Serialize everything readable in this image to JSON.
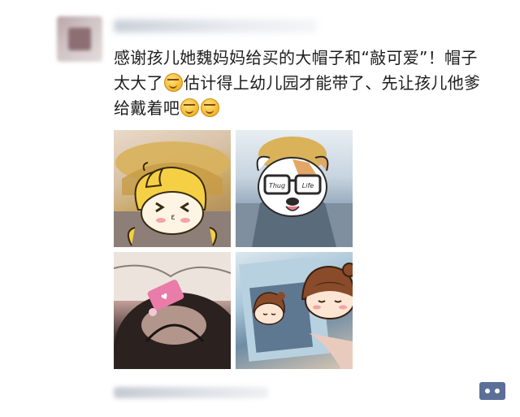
{
  "post": {
    "lines": [
      "感谢孩儿她魏妈妈给买的大帽子和“敲可爱”！帽子",
      "太大了",
      "估计得上幼儿园才能带了、先让孩儿他爹",
      "给戴着吧"
    ]
  },
  "photos": {
    "photo_2_sticker": {
      "lens_left": "Thug",
      "lens_right": "Life"
    }
  },
  "emoji_names": [
    "laugh-cry-emoji",
    "laugh-cry-emoji",
    "laugh-cry-emoji"
  ],
  "colors": {
    "comment_button": "#5b6f98",
    "text": "#1d1d1d"
  }
}
